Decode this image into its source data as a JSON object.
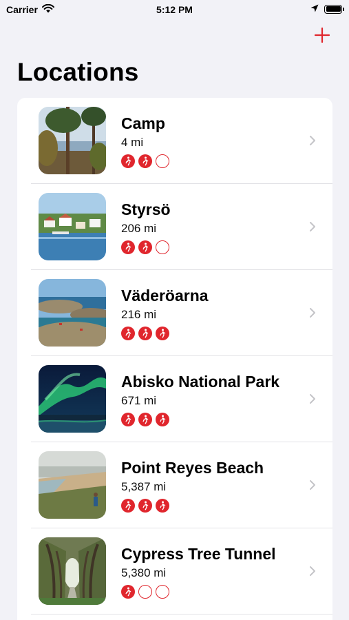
{
  "status_bar": {
    "carrier": "Carrier",
    "time": "5:12 PM"
  },
  "header": {
    "title": "Locations"
  },
  "colors": {
    "accent": "#e0262d",
    "background": "#f2f2f7",
    "card": "#ffffff"
  },
  "locations": [
    {
      "name": "Camp",
      "distance": "4 mi",
      "difficulty": 2,
      "max_difficulty": 3,
      "thumb": "forest-lake"
    },
    {
      "name": "Styrsö",
      "distance": "206 mi",
      "difficulty": 2,
      "max_difficulty": 3,
      "thumb": "harbor-village"
    },
    {
      "name": "Väderöarna",
      "distance": "216 mi",
      "difficulty": 3,
      "max_difficulty": 3,
      "thumb": "rocky-islands"
    },
    {
      "name": "Abisko National Park",
      "distance": "671 mi",
      "difficulty": 3,
      "max_difficulty": 3,
      "thumb": "aurora"
    },
    {
      "name": "Point Reyes Beach",
      "distance": "5,387 mi",
      "difficulty": 3,
      "max_difficulty": 3,
      "thumb": "coastal-cliff"
    },
    {
      "name": "Cypress Tree Tunnel",
      "distance": "5,380 mi",
      "difficulty": 1,
      "max_difficulty": 3,
      "thumb": "tree-tunnel"
    }
  ]
}
